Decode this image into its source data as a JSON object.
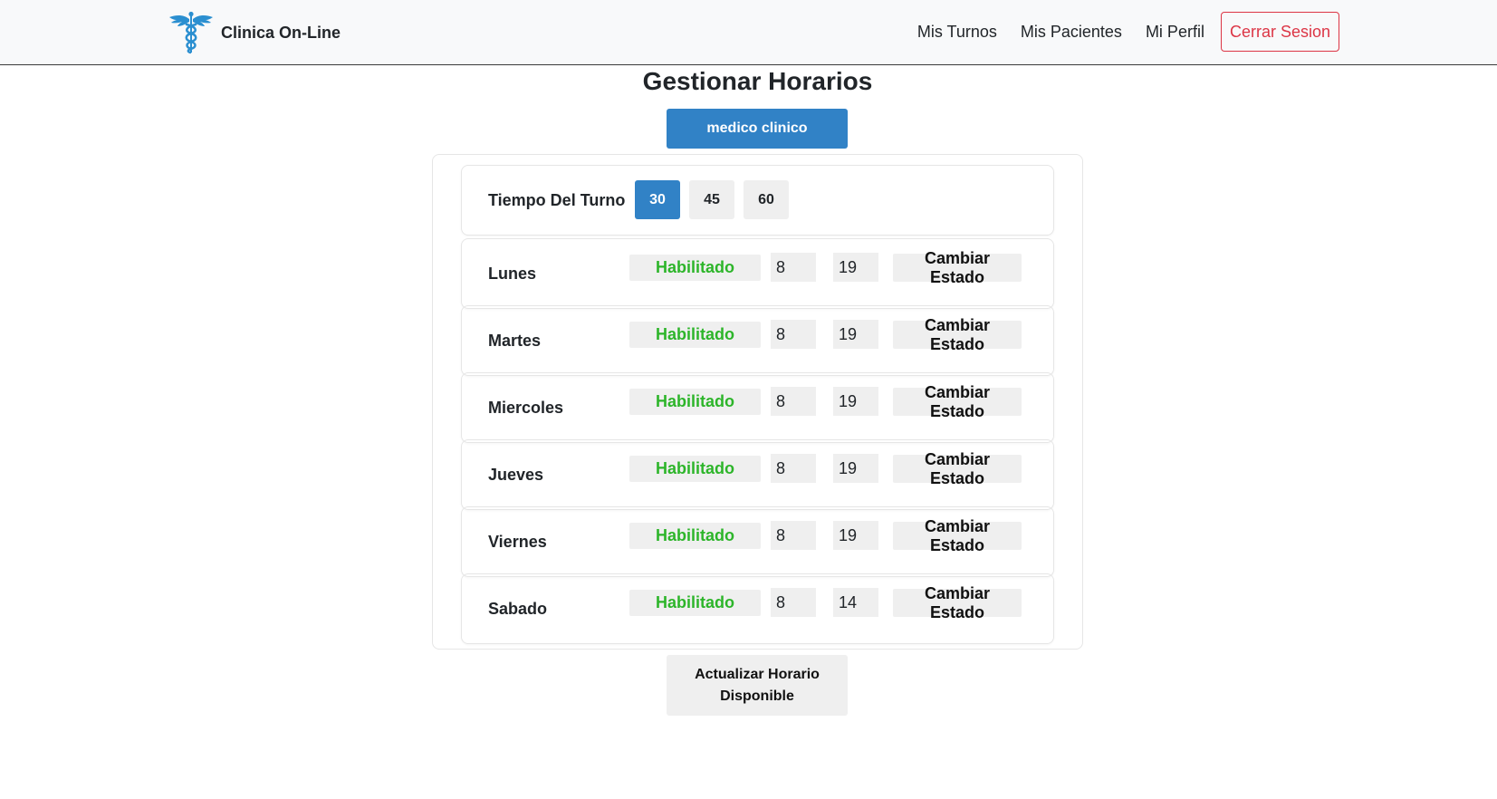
{
  "header": {
    "brand_name": "Clinica On-Line",
    "logo_icon": "caduceus-icon",
    "nav": {
      "turnos": "Mis Turnos",
      "pacientes": "Mis Pacientes",
      "perfil": "Mi Perfil",
      "logout": "Cerrar Sesion"
    }
  },
  "colors": {
    "primary": "#3182c6",
    "enabled_text": "#2db52a",
    "danger": "#dc3545",
    "button_bg": "#efefef"
  },
  "main": {
    "title": "Gestionar Horarios",
    "specialty": "medico clinico",
    "duration": {
      "label": "Tiempo Del Turno",
      "options": [
        "30",
        "45",
        "60"
      ],
      "selected": "30"
    },
    "days": [
      {
        "name": "Lunes",
        "status": "Habilitado",
        "start": "8",
        "end": "19",
        "action": "Cambiar Estado"
      },
      {
        "name": "Martes",
        "status": "Habilitado",
        "start": "8",
        "end": "19",
        "action": "Cambiar Estado"
      },
      {
        "name": "Miercoles",
        "status": "Habilitado",
        "start": "8",
        "end": "19",
        "action": "Cambiar Estado"
      },
      {
        "name": "Jueves",
        "status": "Habilitado",
        "start": "8",
        "end": "19",
        "action": "Cambiar Estado"
      },
      {
        "name": "Viernes",
        "status": "Habilitado",
        "start": "8",
        "end": "19",
        "action": "Cambiar Estado"
      },
      {
        "name": "Sabado",
        "status": "Habilitado",
        "start": "8",
        "end": "14",
        "action": "Cambiar Estado"
      }
    ],
    "update_button": "Actualizar Horario Disponible"
  }
}
